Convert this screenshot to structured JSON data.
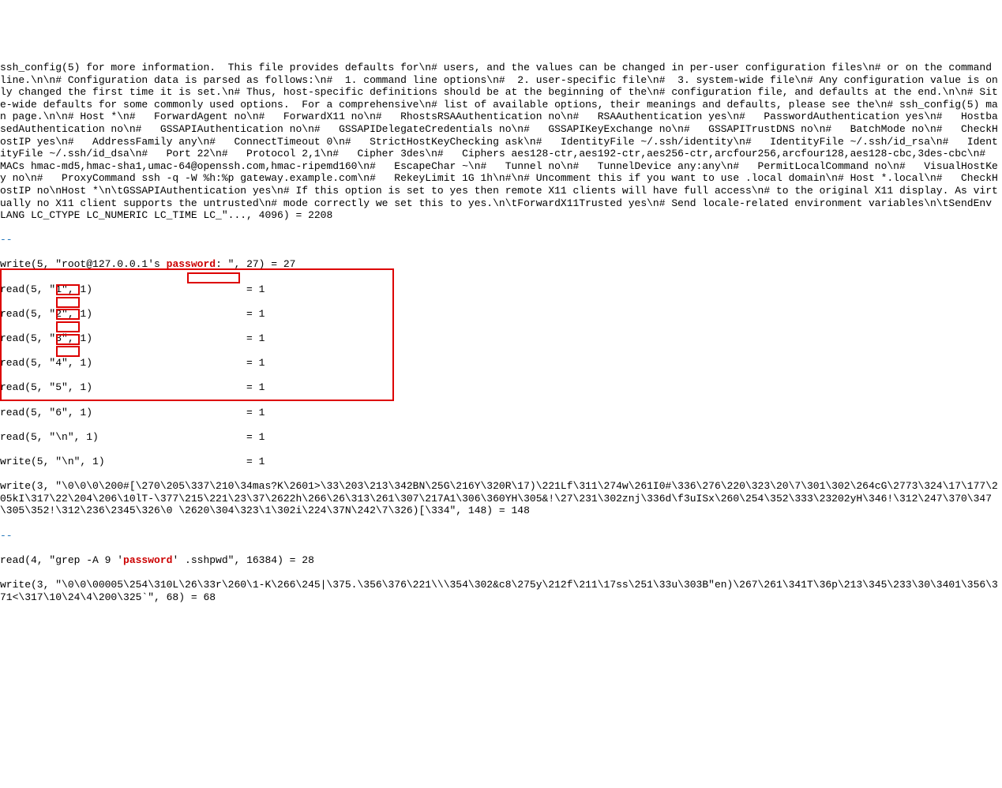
{
  "lines": {
    "config_block": "ssh_config(5) for more information.  This file provides defaults for\\n# users, and the values can be changed in per-user configuration files\\n# or on the command line.\\n\\n# Configuration data is parsed as follows:\\n#  1. command line options\\n#  2. user-specific file\\n#  3. system-wide file\\n# Any configuration value is only changed the first time it is set.\\n# Thus, host-specific definitions should be at the beginning of the\\n# configuration file, and defaults at the end.\\n\\n# Site-wide defaults for some commonly used options.  For a comprehensive\\n# list of available options, their meanings and defaults, please see the\\n# ssh_config(5) man page.\\n\\n# Host *\\n#   ForwardAgent no\\n#   ForwardX11 no\\n#   RhostsRSAAuthentication no\\n#   RSAAuthentication yes\\n#   PasswordAuthentication yes\\n#   HostbasedAuthentication no\\n#   GSSAPIAuthentication no\\n#   GSSAPIDelegateCredentials no\\n#   GSSAPIKeyExchange no\\n#   GSSAPITrustDNS no\\n#   BatchMode no\\n#   CheckHostIP yes\\n#   AddressFamily any\\n#   ConnectTimeout 0\\n#   StrictHostKeyChecking ask\\n#   IdentityFile ~/.ssh/identity\\n#   IdentityFile ~/.ssh/id_rsa\\n#   IdentityFile ~/.ssh/id_dsa\\n#   Port 22\\n#   Protocol 2,1\\n#   Cipher 3des\\n#   Ciphers aes128-ctr,aes192-ctr,aes256-ctr,arcfour256,arcfour128,aes128-cbc,3des-cbc\\n#   MACs hmac-md5,hmac-sha1,umac-64@openssh.com,hmac-ripemd160\\n#   EscapeChar ~\\n#   Tunnel no\\n#   TunnelDevice any:any\\n#   PermitLocalCommand no\\n#   VisualHostKey no\\n#   ProxyCommand ssh -q -W %h:%p gateway.example.com\\n#   RekeyLimit 1G 1h\\n#\\n# Uncomment this if you want to use .local domain\\n# Host *.local\\n#   CheckHostIP no\\nHost *\\n\\tGSSAPIAuthentication yes\\n# If this option is set to yes then remote X11 clients will have full access\\n# to the original X11 display. As virtually no X11 client supports the untrusted\\n# mode correctly we set this to yes.\\n\\tForwardX11Trusted yes\\n# Send locale-related environment variables\\n\\tSendEnv LANG LC_CTYPE LC_NUMERIC LC_TIME LC_\"..., 4096) = 2208",
    "sep1": "--",
    "write_prompt_pre": "write(5, \"root@127.0.0.1's ",
    "write_prompt_highlight": "password",
    "write_prompt_post": ": \", 27) = 27",
    "read1": "read(5, \"1\", 1)                         = 1",
    "read2": "read(5, \"2\", 1)                         = 1",
    "read3": "read(5, \"3\", 1)                         = 1",
    "read4": "read(5, \"4\", 1)                         = 1",
    "read5": "read(5, \"5\", 1)                         = 1",
    "read6": "read(5, \"6\", 1)                         = 1",
    "read_nl": "read(5, \"\\n\", 1)                        = 1",
    "write_nl": "write(5, \"\\n\", 1)                       = 1",
    "write3": "write(3, \"\\0\\0\\0\\200#[\\270\\205\\337\\210\\34mas?K\\2601>\\33\\203\\213\\342BN\\25G\\216Y\\320R\\17)\\221Lf\\311\\274w\\261I0#\\336\\276\\220\\323\\20\\7\\301\\302\\264cG\\2773\\324\\17\\177\\205kI\\317\\22\\204\\206\\10lT-\\377\\215\\221\\23\\37\\2622h\\266\\26\\313\\261\\307\\217A1\\306\\360YH\\305&!\\27\\231\\302znj\\336d\\f3uISx\\260\\254\\352\\333\\23202yH\\346!\\312\\247\\370\\347\\305\\352!\\312\\236\\2345\\326\\0 \\2620\\304\\323\\1\\302i\\224\\37N\\242\\7\\326)[\\334\", 148) = 148",
    "sep2": "--",
    "read4_pre": "read(4, \"grep -A 9 '",
    "read4_hl": "password",
    "read4_post": "' .sshpwd\", 16384) = 28",
    "write3b": "write(3, \"\\0\\0\\00005\\254\\310L\\26\\33r\\260\\1-K\\266\\245|\\375.\\356\\376\\221\\\\\\354\\302&c8\\275y\\212f\\211\\17ss\\251\\33u\\303B\"en)\\267\\261\\341T\\36p\\213\\345\\233\\30\\3401\\356\\371<\\317\\10\\24\\4\\200\\325`\", 68) = 68"
  }
}
